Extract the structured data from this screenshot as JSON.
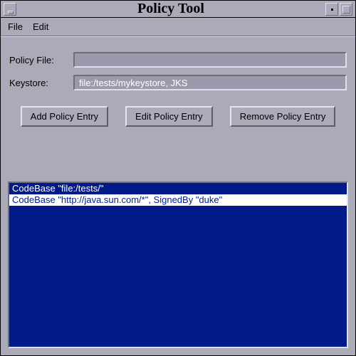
{
  "window": {
    "title": "Policy Tool"
  },
  "menubar": {
    "file": "File",
    "edit": "Edit"
  },
  "form": {
    "policy_label": "Policy File:",
    "policy_value": "",
    "keystore_label": "Keystore:",
    "keystore_value": "file:/tests/mykeystore, JKS"
  },
  "buttons": {
    "add": "Add Policy Entry",
    "edit": "Edit Policy Entry",
    "remove": "Remove Policy Entry"
  },
  "entries": [
    {
      "label": "CodeBase \"file:/tests/\"",
      "selected": false
    },
    {
      "label": "CodeBase \"http://java.sun.com/*\", SignedBy \"duke\"",
      "selected": true
    }
  ]
}
